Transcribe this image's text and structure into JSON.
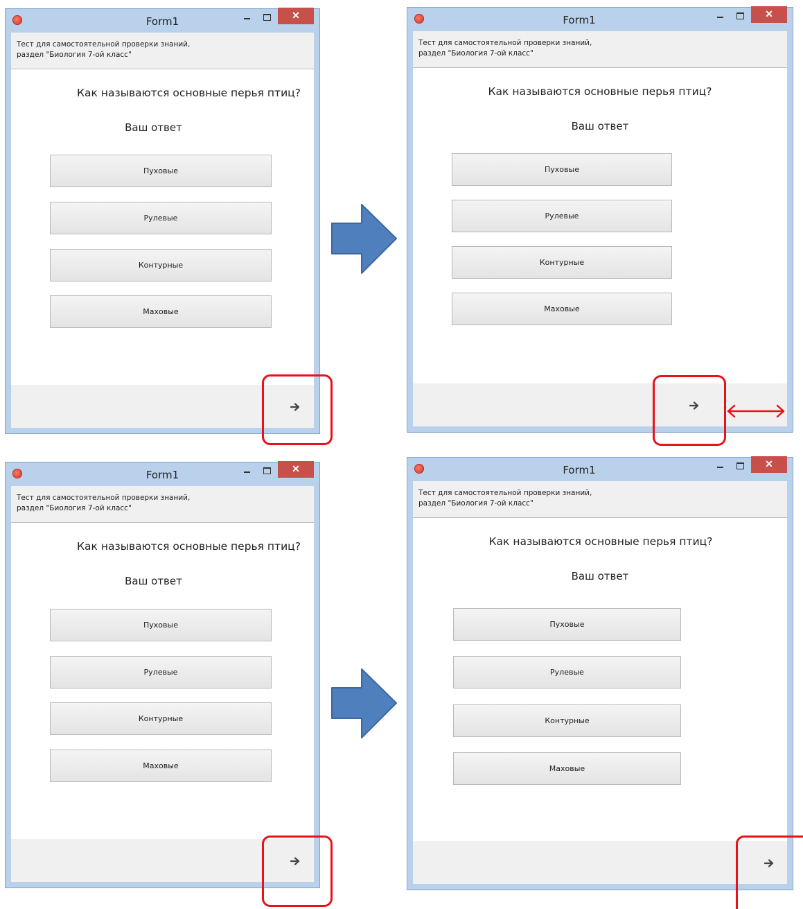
{
  "panels": [
    {
      "window_title": "Form1",
      "header_line1": "Тест для самостоятельной проверки знаний,",
      "header_line2": "раздел \"Биология 7-ой класс\"",
      "question": "Как называются основные перья птиц?",
      "answer_label": "Ваш ответ",
      "options": [
        "Пуховые",
        "Рулевые",
        "Контурные",
        "Маховые"
      ],
      "next_icon": "arrow-right-icon",
      "close_glyph": "✕"
    },
    {
      "window_title": "Form1",
      "header_line1": "Тест для самостоятельной проверки знаний,",
      "header_line2": "раздел \"Биология 7-ой класс\"",
      "question": "Как называются основные перья птиц?",
      "answer_label": "Ваш ответ",
      "options": [
        "Пуховые",
        "Рулевые",
        "Контурные",
        "Маховые"
      ],
      "next_icon": "arrow-right-icon",
      "close_glyph": "✕"
    },
    {
      "window_title": "Form1",
      "header_line1": "Тест для самостоятельной проверки знаний,",
      "header_line2": "раздел \"Биология 7-ой класс\"",
      "question": "Как называются основные перья птиц?",
      "answer_label": "Ваш ответ",
      "options": [
        "Пуховые",
        "Рулевые",
        "Контурные",
        "Маховые"
      ],
      "next_icon": "arrow-right-icon",
      "close_glyph": "✕"
    },
    {
      "window_title": "Form1",
      "header_line1": "Тест для самостоятельной проверки знаний,",
      "header_line2": "раздел \"Биология 7-ой класс\"",
      "question": "Как называются основные перья птиц?",
      "answer_label": "Ваш ответ",
      "options": [
        "Пуховые",
        "Рулевые",
        "Контурные",
        "Маховые"
      ],
      "next_icon": "arrow-right-icon",
      "close_glyph": "✕"
    }
  ],
  "colors": {
    "highlight": "#e8121a",
    "flow_arrow": "#4f7fbd",
    "titlebar": "#b9d1ea",
    "close_button": "#c7504a"
  },
  "annotations": {
    "flow_arrow_icon": "big-right-arrow-icon",
    "resize_arrow_icon": "double-headed-arrow-icon"
  }
}
